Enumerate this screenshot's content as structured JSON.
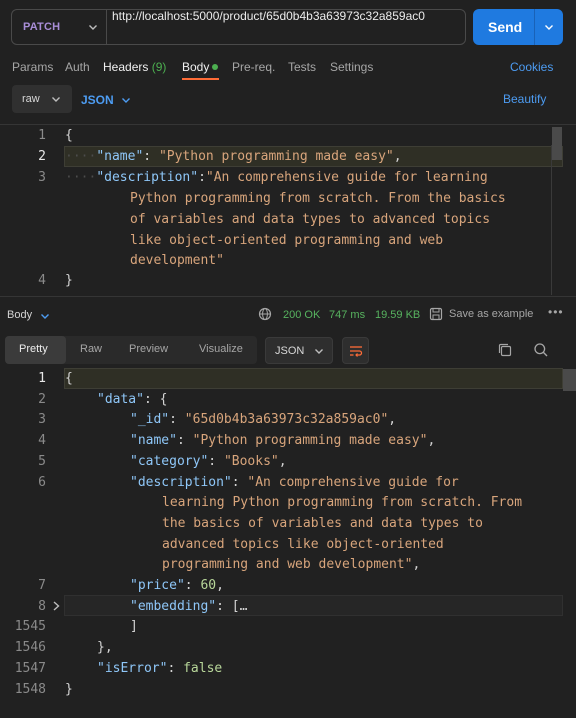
{
  "request": {
    "method": "PATCH",
    "url": "http://localhost:5000/product/65d0b4b3a63973c32a859ac0",
    "send_label": "Send"
  },
  "tabs": {
    "params": "Params",
    "auth": "Auth",
    "headers": "Headers",
    "headers_count": "(9)",
    "body": "Body",
    "prereq": "Pre-req.",
    "tests": "Tests",
    "settings": "Settings",
    "cookies": "Cookies"
  },
  "body_options": {
    "mode": "raw",
    "language": "JSON",
    "beautify": "Beautify"
  },
  "request_body": {
    "line_numbers": [
      "1",
      "2",
      "3",
      "4"
    ],
    "open_brace": "{",
    "close_brace": "}",
    "name_key": "\"name\"",
    "name_value": "\"Python programming made easy\"",
    "desc_key": "\"description\"",
    "desc_lines": [
      "\"An comprehensive guide for learning",
      "Python programming from scratch. From the basics",
      "of variables and data types to advanced topics",
      "like object-oriented programming and web",
      "development\""
    ]
  },
  "response_meta": {
    "body_label": "Body",
    "status": "200 OK",
    "time": "747 ms",
    "size": "19.59 KB",
    "save_label": "Save as example",
    "more": "•••"
  },
  "response_view": {
    "tabs": [
      "Pretty",
      "Raw",
      "Preview",
      "Visualize"
    ],
    "selected_tab": "Pretty",
    "format": "JSON"
  },
  "response_body": {
    "line_numbers": [
      "1",
      "2",
      "3",
      "4",
      "5",
      "6",
      "7",
      "8",
      "1545",
      "1546",
      "1547",
      "1548"
    ],
    "open_brace": "{",
    "data_key": "\"data\"",
    "id_key": "\"_id\"",
    "id_value": "\"65d0b4b3a63973c32a859ac0\"",
    "name_key": "\"name\"",
    "name_value": "\"Python programming made easy\"",
    "category_key": "\"category\"",
    "category_value": "\"Books\"",
    "desc_key": "\"description\"",
    "desc_lines": [
      "\"An comprehensive guide for",
      "learning Python programming from scratch. From",
      "the basics of variables and data types to",
      "advanced topics like object-oriented",
      "programming and web development\""
    ],
    "price_key": "\"price\"",
    "price_value": "60",
    "embedding_key": "\"embedding\"",
    "embedding_fold": "[…",
    "close_bracket": "]",
    "close_data": "},",
    "iserror_key": "\"isError\"",
    "iserror_value": "false",
    "close_brace": "}"
  },
  "colors": {
    "accent": "#1f7ae0",
    "method": "#a98ed8",
    "status_ok": "#57b35f",
    "tab_underline": "#ff6c37",
    "json_key": "#8fc7f8",
    "json_string": "#d8a57c",
    "json_number": "#b8d79a"
  }
}
